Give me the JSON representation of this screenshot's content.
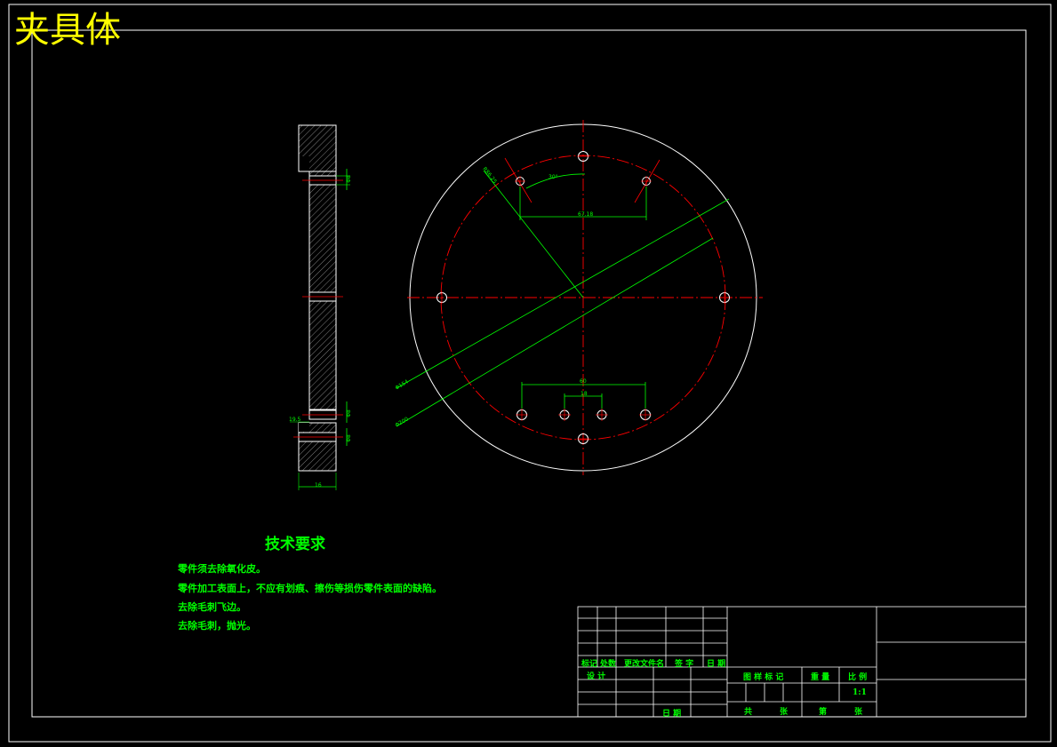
{
  "drawing": {
    "title": "夹具体",
    "colors": {
      "background": "#000000",
      "outline": "#ffffff",
      "dimension": "#00ff00",
      "centerline": "#ff0000",
      "title": "#ffff00"
    }
  },
  "dimensions": {
    "side_hole_upper": "Φ8",
    "side_thickness": "16",
    "side_hole_lower_a": "Φ8",
    "side_hole_lower_b": "Φ8",
    "side_offset": "19.5",
    "angle_label": "30°",
    "radius_label": "R86.25",
    "top_span": "67.18",
    "bottom_span_outer": "60",
    "bottom_span_inner": "18",
    "diameter_a": "Φ154",
    "diameter_b": "Φ200"
  },
  "technical_requirements": {
    "title": "技术要求",
    "items": [
      "零件须去除氧化皮。",
      "零件加工表面上，不应有划痕、擦伤等损伤零件表面的缺陷。",
      "去除毛刺飞边。",
      "去除毛刺，抛光。"
    ]
  },
  "title_block": {
    "mark": "标记",
    "count": "处数",
    "change_doc": "更改文件名",
    "signature": "签 字",
    "date": "日 期",
    "designer": "设 计",
    "stage_mark": "图 样 标 记",
    "weight": "重 量",
    "scale_label": "比 例",
    "scale_value": "1:1",
    "approve_date": "日 期",
    "sheet_total": "共",
    "sheet_unit": "张",
    "sheet_no": "第",
    "sheet_unit2": "张"
  }
}
